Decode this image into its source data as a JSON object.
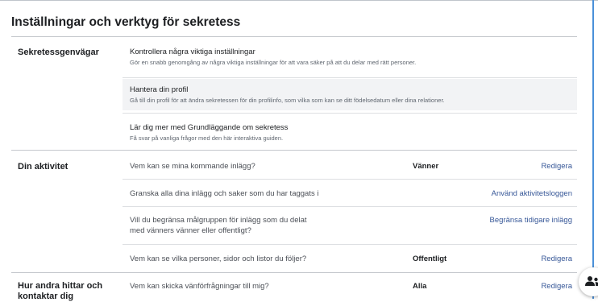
{
  "page": {
    "title": "Inställningar och verktyg för sekretess"
  },
  "shortcuts": {
    "label": "Sekretessgenvägar",
    "items": [
      {
        "title": "Kontrollera några viktiga inställningar",
        "desc": "Gör en snabb genomgång av några viktiga inställningar för att vara säker på att du delar med rätt personer."
      },
      {
        "title": "Hantera din profil",
        "desc": "Gå till din profil för att ändra sekretessen för din profilinfo, som vilka som kan se ditt födelsedatum eller dina relationer."
      },
      {
        "title": "Lär dig mer med Grundläggande om sekretess",
        "desc": "Få svar på vanliga frågor med den här interaktiva guiden."
      }
    ]
  },
  "activity": {
    "label": "Din aktivitet",
    "rows": [
      {
        "question": "Vem kan se mina kommande inlägg?",
        "value": "Vänner",
        "action": "Redigera"
      },
      {
        "question": "Granska alla dina inlägg och saker som du har taggats i",
        "value": "",
        "action": "Använd aktivitetsloggen"
      },
      {
        "question_line1": "Vill du begränsa målgruppen för inlägg som du delat",
        "question_line2": "med vänners vänner eller offentligt?",
        "value": "",
        "action": "Begränsa tidigare inlägg"
      },
      {
        "question": "Vem kan se vilka personer, sidor och listor du följer?",
        "value": "Offentligt",
        "action": "Redigera"
      }
    ]
  },
  "find": {
    "label_line1": "Hur andra hittar och",
    "label_line2": "kontaktar dig",
    "rows": [
      {
        "question": "Vem kan skicka vänförfrågningar till mig?",
        "value": "Alla",
        "action": "Redigera"
      }
    ]
  },
  "fab": {
    "icon": "people-icon"
  }
}
